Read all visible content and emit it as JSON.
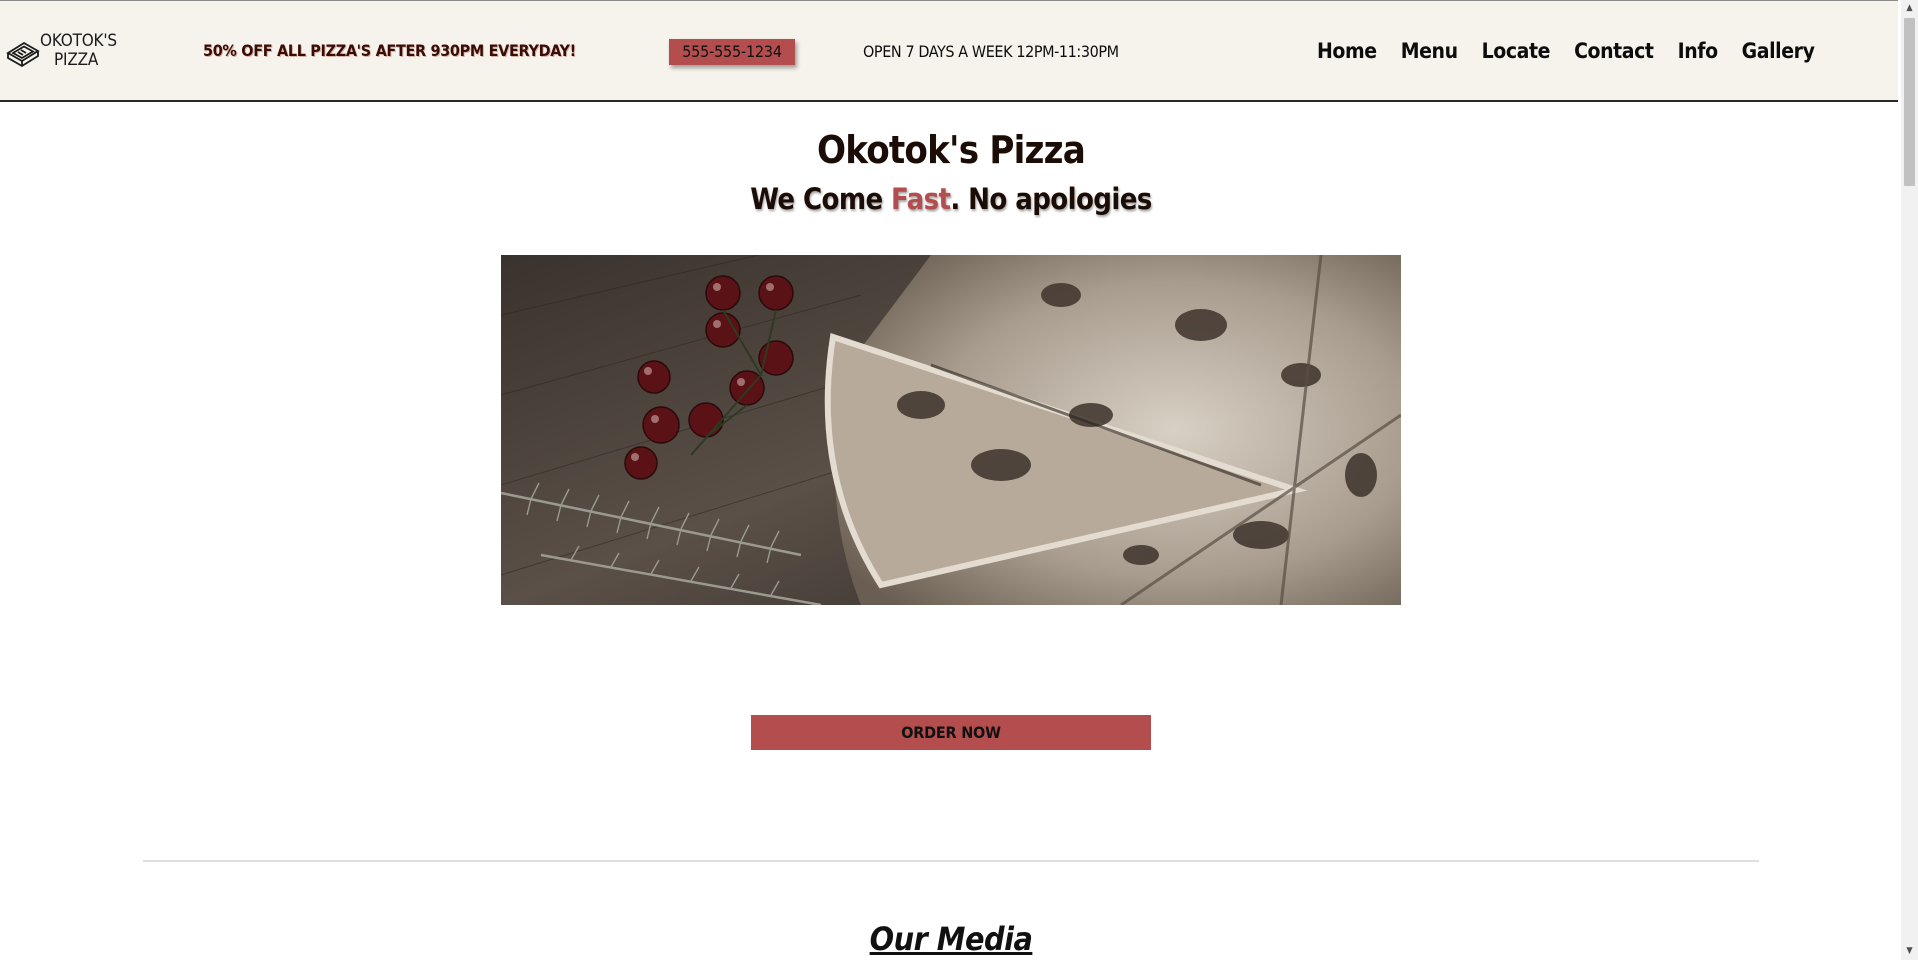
{
  "header": {
    "logo_line1": "OKOTOK'S",
    "logo_line2": "PIZZA",
    "promo": "50% OFF ALL PIZZA'S AFTER 930PM EVERYDAY!",
    "phone": "555-555-1234",
    "hours": "OPEN 7 DAYS A WEEK 12PM-11:30PM",
    "nav": [
      "Home",
      "Menu",
      "Locate",
      "Contact",
      "Info",
      "Gallery"
    ]
  },
  "hero": {
    "title": "Okotok's Pizza",
    "subtitle_pre": "We Come ",
    "subtitle_accent": "Fast",
    "subtitle_post": ". No apologies",
    "image_icon": "pizza-photo"
  },
  "order_button": "ORDER NOW",
  "media_title": "Our Media",
  "colors": {
    "accent": "#b34d4e",
    "header_bg": "#f6f3ed",
    "text_dark": "#1b0c06"
  }
}
